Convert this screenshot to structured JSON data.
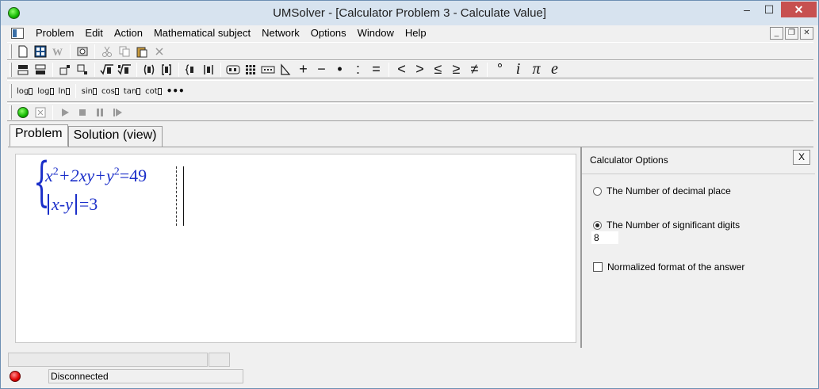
{
  "window": {
    "title": "UMSolver - [Calculator Problem 3 - Calculate Value]",
    "controls": {
      "minimize": "–",
      "maximize": "☐",
      "close": "✕"
    }
  },
  "menu": {
    "items": [
      "Problem",
      "Edit",
      "Action",
      "Mathematical subject",
      "Network",
      "Options",
      "Window",
      "Help"
    ],
    "mdi_controls": {
      "minimize": "_",
      "restore": "❐",
      "close": "✕"
    }
  },
  "toolbar3": {
    "functions": [
      "log",
      "log",
      "ln",
      "sin",
      "cos",
      "tan",
      "cot"
    ],
    "more": "•••"
  },
  "toolbar2": {
    "symbols": [
      "+",
      "−",
      "•",
      ":",
      "=",
      "<",
      ">",
      "≤",
      "≥",
      "≠",
      "°",
      "i",
      "π",
      "e"
    ]
  },
  "tabs": [
    {
      "label": "Problem",
      "active": true
    },
    {
      "label": "Solution (view)",
      "active": false
    }
  ],
  "formula": {
    "line1": {
      "x": "x",
      "exp1": "2",
      "mid": "+2xy+y",
      "exp2": "2",
      "rhs": "=49"
    },
    "line2": {
      "expr": "x-y",
      "rhs": "=3"
    }
  },
  "panel": {
    "title": "Calculator Options",
    "close": "X",
    "options": {
      "decimal_place": "The Number of decimal place",
      "significant_digits": "The Number of significant digits",
      "significant_digits_value": "8",
      "normalized": "Normalized format of the answer"
    },
    "selected": "significant_digits",
    "normalized_checked": false
  },
  "status": {
    "connection": "Disconnected"
  }
}
